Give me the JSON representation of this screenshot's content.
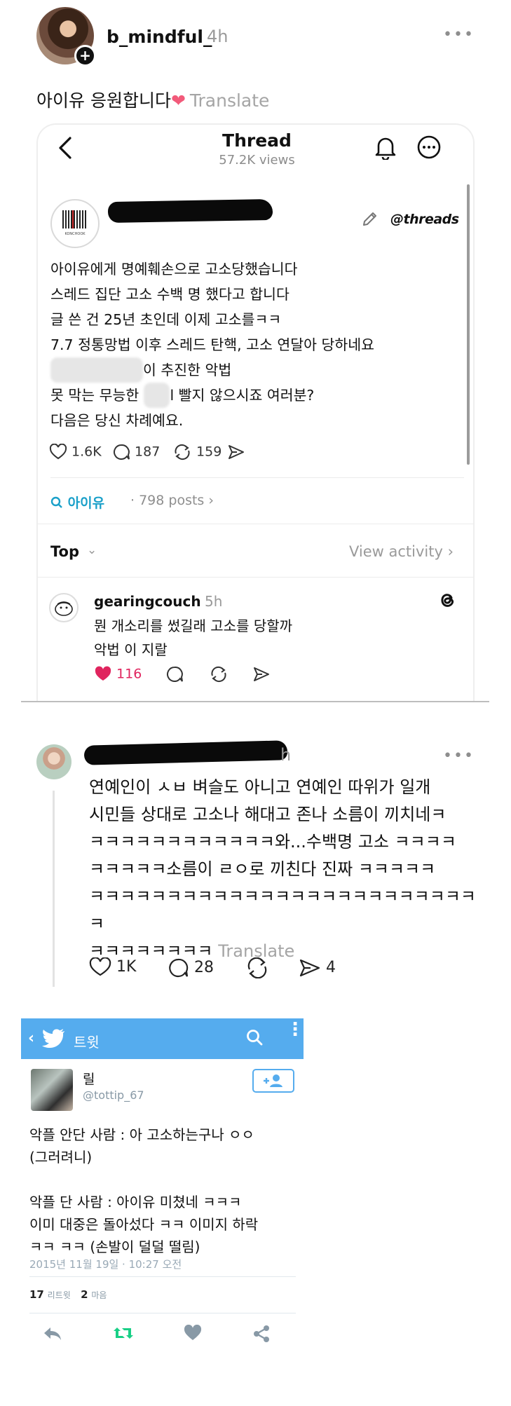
{
  "post": {
    "username": "b_mindful_",
    "time": "4h",
    "more": "•••",
    "text": "아이유 응원합니다",
    "heart": "❤",
    "translate": "Translate"
  },
  "embed": {
    "header": {
      "title": "Thread",
      "views": "57.2K views"
    },
    "threads_badge": "@threads",
    "logo_text": "KONCHOOK",
    "body": [
      "아이유에게 명예훼손으로 고소당했습니다",
      "스레드 집단 고소 수백 명 했다고 합니다",
      "글 쓴 건 25년 초인데 이제 고소를ㅋㅋ",
      "7.7 정통망법 이후 스레드 탄핵, 고소 연달아 당하네요",
      "이 추진한 악법",
      "못 막는 무능한 ",
      "l 빨지 않으시죠 여러분?",
      "다음은 당신 차례예요."
    ],
    "actions": {
      "likes": "1.6K",
      "replies": "187",
      "reposts": "159"
    },
    "topic": {
      "name": "아이유",
      "count": "· 798 posts ›"
    },
    "sort": {
      "label": "Top",
      "chevron": "⌄",
      "view_activity": "View activity ›"
    },
    "reply": {
      "username": "gearingcouch",
      "time": "5h",
      "lines": [
        "뭔 개소리를 썼길래 고소를 당할까",
        "악법 이 지랄"
      ],
      "likes": "116"
    }
  },
  "comment": {
    "time_fragment": "h",
    "more": "•••",
    "lines": [
      "연예인이 ㅅㅂ 벼슬도 아니고 연예인 따위가 일개",
      "시민들 상대로 고소나 해대고 존나 소름이 끼치네ㅋ",
      "ㅋㅋㅋㅋㅋㅋㅋㅋㅋㅋㅋㅋ와...수백명 고소 ㅋㅋㅋㅋ",
      "ㅋㅋㅋㅋㅋ소름이 ㄹㅇ로 끼친다 진짜 ㅋㅋㅋㅋㅋ",
      "ㅋㅋㅋㅋㅋㅋㅋㅋㅋㅋㅋㅋㅋㅋㅋㅋㅋㅋㅋㅋㅋㅋㅋㅋㅋㅋ",
      "ㅋㅋㅋㅋㅋㅋㅋㅋ"
    ],
    "translate": "Translate",
    "actions": {
      "likes": "1K",
      "replies": "28",
      "shares": "4"
    }
  },
  "tweet": {
    "header_title": "트윗",
    "name": "릴",
    "handle": "@tottip_67",
    "lines": [
      "악플 안단 사람 : 아 고소하는구나 ㅇㅇ",
      "(그러려니)",
      "",
      "악플 단 사람 : 아이유 미쳤네 ㅋㅋㅋ",
      "이미 대중은 돌아섰다 ㅋㅋ 이미지 하락",
      "ㅋㅋ ㅋㅋ (손발이 덜덜 떨림)"
    ],
    "date": "2015년 11월 19일 · 10:27 오전",
    "retweets": "17",
    "retweets_label": "리트윗",
    "likes": "2",
    "likes_label": "마음"
  },
  "colors": {
    "accent_topic": "#1aa0c9",
    "like_red": "#e0245e",
    "twitter_blue": "#55acee"
  }
}
